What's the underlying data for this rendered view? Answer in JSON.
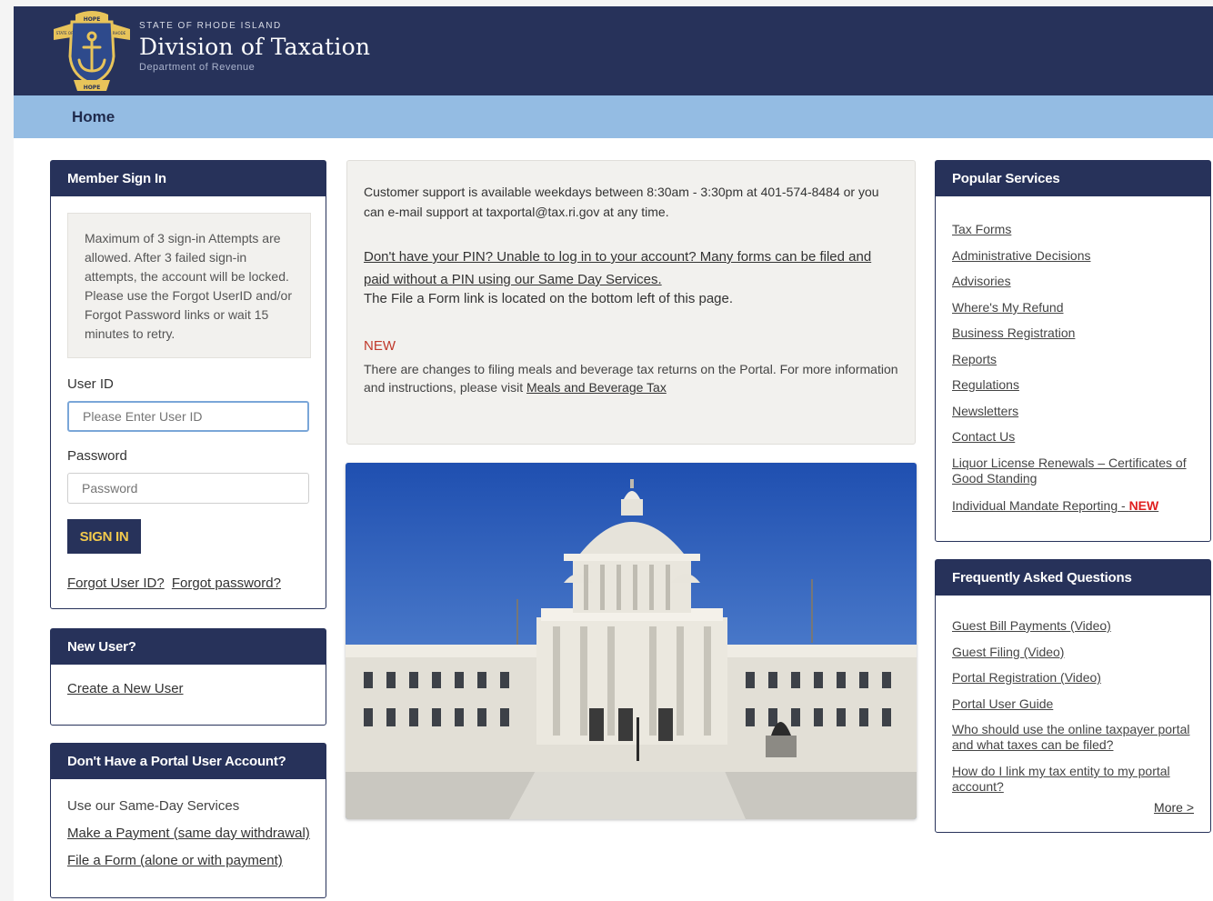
{
  "header": {
    "state": "STATE OF RHODE ISLAND",
    "title": "Division of Taxation",
    "subtitle": "Department of Revenue",
    "seal_top": "HOPE",
    "seal_bottom": "HOPE",
    "seal_left": "STATE OF",
    "seal_right": "RHODE",
    "colors": {
      "navy": "#27325a",
      "light_blue": "#94bce3",
      "gold": "#f2c94c"
    }
  },
  "nav": {
    "home": "Home"
  },
  "signin": {
    "title": "Member Sign In",
    "warning": "Maximum of 3 sign-in Attempts are allowed. After 3 failed sign-in attempts, the account will be locked. Please use the Forgot UserID and/or Forgot Password links or wait 15 minutes to retry.",
    "userid_label": "User ID",
    "userid_placeholder": "Please Enter User ID",
    "userid_value": "",
    "password_label": "Password",
    "password_placeholder": "Password",
    "password_value": "",
    "button": "SIGN IN",
    "forgot_userid": "Forgot User ID?",
    "forgot_password": "Forgot password?"
  },
  "new_user": {
    "title": "New User?",
    "link": "Create a New User"
  },
  "no_account": {
    "title": "Don't Have a Portal User Account?",
    "text": "Use our Same-Day Services",
    "payment_link": "Make a Payment (same day withdrawal)",
    "form_link": "File a Form (alone or with payment)"
  },
  "info": {
    "support": "Customer support is available weekdays between 8:30am - 3:30pm at 401-574-8484 or you can e-mail support at taxportal@tax.ri.gov at any time.",
    "pin_link": "Don't have your PIN? Unable to log in to your account? Many forms can be filed and paid without a PIN using our Same Day Services.",
    "file_form_note": "The File a Form link is located on the bottom left of this page.",
    "new_label": "NEW",
    "meals_text": "There are changes to filing meals and beverage tax returns on the Portal. For more information and instructions, please visit ",
    "meals_link": "Meals and Beverage Tax"
  },
  "popular": {
    "title": "Popular Services",
    "items": [
      "Tax Forms",
      "Administrative Decisions",
      "Advisories",
      "Where's My Refund",
      "Business Registration",
      "Reports",
      "Regulations",
      "Newsletters",
      "Contact Us",
      "Liquor License Renewals – Certificates of Good Standing",
      "Individual Mandate Reporting - "
    ],
    "new_tag": "NEW"
  },
  "faq": {
    "title": "Frequently Asked Questions",
    "items": [
      "Guest Bill Payments (Video)",
      "Guest Filing (Video)",
      "Portal Registration (Video)",
      "Portal User Guide",
      "Who should use the online taxpayer portal and what taxes can be filed?",
      "How do I link my tax entity to my portal account?"
    ],
    "more": "More >"
  }
}
